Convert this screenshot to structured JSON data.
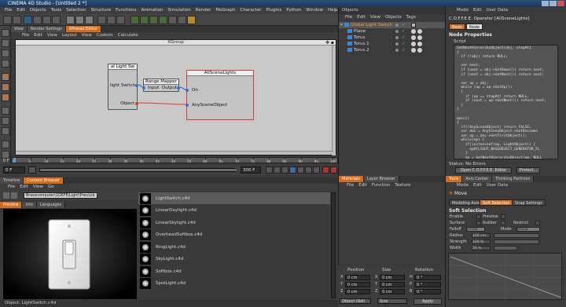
{
  "app": {
    "title": "CINEMA 4D Studio - [Untitled 2 *]"
  },
  "menubar": [
    "File",
    "Edit",
    "Objects",
    "Tools",
    "Selection",
    "Structure",
    "Functions",
    "Animation",
    "Simulation",
    "Render",
    "MoGraph",
    "Character",
    "Plugins",
    "Python",
    "Window",
    "Help"
  ],
  "viewport_tabs": [
    "View",
    "Render Settings",
    "XPresso Editor"
  ],
  "xpresso": {
    "menu": [
      "File",
      "Edit",
      "View",
      "Layout",
      "View",
      "Custom",
      "Calculate"
    ],
    "group_title": "XGroup",
    "node_light": {
      "title": "al Light Sw",
      "port1": "light Switch",
      "port2": "Object"
    },
    "node_range": {
      "title": "Range Mapper",
      "in": "Input",
      "out": "Output"
    },
    "node_all": {
      "title": "AllSceneLights",
      "port1": "On",
      "port2": "AnySceneObject"
    }
  },
  "timeline": {
    "ticks": [
      "0",
      "5",
      "10",
      "15",
      "20",
      "25",
      "30",
      "35",
      "40",
      "45",
      "50",
      "55",
      "60",
      "65",
      "70",
      "75",
      "80",
      "85",
      "90",
      "95",
      "100"
    ],
    "frame_start": "0 F",
    "frame_current": "0 F",
    "frame_end": "300 F",
    "frame_end2": "300 F",
    "frame_display": "0 F"
  },
  "content_browser": {
    "tabs": [
      "Timeline",
      "Content Browser"
    ],
    "menu": [
      "File",
      "Edit",
      "View",
      "Go"
    ],
    "path": "Brasscomputer\\1DEFE\\Light\\Pres\\Lib",
    "preview_tabs": [
      "Preview",
      "Info",
      "Languages"
    ],
    "items": [
      {
        "name": "LightSwitch.c4d"
      },
      {
        "name": "LinearDaylight.c4d"
      },
      {
        "name": "LinearSkylight.c4d"
      },
      {
        "name": "OverheadSoftbox.c4d"
      },
      {
        "name": "RingLight.c4d"
      },
      {
        "name": "SkyLight.c4d"
      },
      {
        "name": "Softbox.c4d"
      },
      {
        "name": "SpotLight.c4d"
      }
    ],
    "status": "Object: LightSwitch.c4d"
  },
  "objects": {
    "title": "Objects",
    "menu": [
      "File",
      "Edit",
      "View",
      "Objects",
      "Tags"
    ],
    "rows": [
      {
        "name": "Global Light Switch",
        "indent": 0
      },
      {
        "name": "Plane",
        "indent": 1
      },
      {
        "name": "Torus",
        "indent": 1
      },
      {
        "name": "Torus.1",
        "indent": 1
      },
      {
        "name": "Torus.2",
        "indent": 1
      }
    ]
  },
  "attributes": {
    "menu": [
      "Mode",
      "Edit",
      "User Data"
    ],
    "operator": "C.O.F.F.E.E. Operator [AllSceneLights]",
    "tabs": [
      "Basic",
      "Node"
    ],
    "section": "Node Properties",
    "script_label": "Script",
    "code": "GetNextHierarchyObject(obj, stopAt)\n{\n  if (!obj) return NULL;\n\n  var next;\n  if (next = obj->GetDown()) return next;\n  if (next = obj->GetNext()) return next;\n\n  var up = obj;\n  while (up = up->GetUp())\n  {\n    if (up == stopAt) return NULL;\n    if (next = up->GetNext()) return next;\n  }\n}\n\nmain()\n{\n  if(!AnySceneObject) return FALSE;\n  var doc = AnySceneObject->GetDocumen\n  var op = doc->GetFirstObject();\n  while(op) {\n    if(instanceof(op, LightObject)) {\n      op#[LIGHT_BASEOBJECT_GENERATOR_FL\n    }\n    op = GetNextHierarchyObject(op, NULL\n  }\n}",
    "status": "Status: No Errors",
    "btn_open": "Open C.O.F.F.E.E. Editor",
    "btn_protect": "Protect..."
  },
  "materials": {
    "tabs": [
      "Materials",
      "Layer Browser"
    ],
    "menu": [
      "File",
      "Edit",
      "Function",
      "Texture"
    ]
  },
  "coordinates": {
    "headers": [
      "Position",
      "Size",
      "Rotation"
    ],
    "rows": [
      {
        "axis": "X",
        "pos": "0 cm",
        "size": "0 cm",
        "rotlabel": "H",
        "rot": "0 °"
      },
      {
        "axis": "Y",
        "pos": "0 cm",
        "size": "0 cm",
        "rotlabel": "P",
        "rot": "0 °"
      },
      {
        "axis": "Z",
        "pos": "0 cm",
        "size": "0 cm",
        "rotlabel": "B",
        "rot": "0 °"
      }
    ],
    "mode_select": "Object (Rel)",
    "size_select": "Size",
    "apply": "Apply"
  },
  "tools": {
    "tabs": [
      "Tools",
      "Axis Center",
      "Thinking Particles"
    ],
    "menu": [
      "Mode",
      "Edit",
      "User Data"
    ],
    "move": "Move",
    "subtabs": [
      "Modeling Axis",
      "Soft Selection",
      "Snap Settings"
    ],
    "section": "Soft Selection",
    "enable": "Enable",
    "preview": "Preview",
    "surface": "Surface",
    "rubber": "Rubber",
    "restrict": "Restrict",
    "falloff": "Falloff",
    "falloff_val": "Linear",
    "mode": "Mode",
    "mode_val": "Group",
    "radius": "Radius",
    "radius_val": "100 cm",
    "strength": "Strength",
    "strength_val": "100 %",
    "width": "Width",
    "width_val": "50 %"
  }
}
